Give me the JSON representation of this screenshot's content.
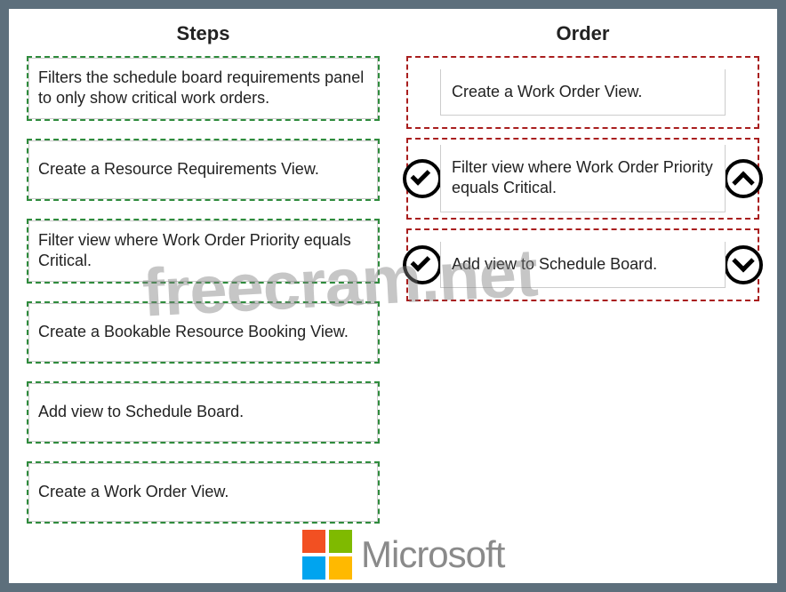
{
  "headers": {
    "steps": "Steps",
    "order": "Order"
  },
  "steps": [
    {
      "text": "Filters the schedule board requirements panel to only show critical work orders."
    },
    {
      "text": "Create a Resource Requirements View."
    },
    {
      "text": "Filter view where Work Order Priority equals Critical."
    },
    {
      "text": "Create a Bookable Resource Booking View."
    },
    {
      "text": "Add view to Schedule Board."
    },
    {
      "text": "Create a Work Order View."
    }
  ],
  "order": [
    {
      "text": "Create a Work Order View.",
      "left_icon": null,
      "right_icon": null
    },
    {
      "text": "Filter view where Work Order Priority equals Critical.",
      "left_icon": "check",
      "right_icon": "up"
    },
    {
      "text": "Add view to Schedule Board.",
      "left_icon": "check",
      "right_icon": "down"
    }
  ],
  "watermark": "freecram.net",
  "logo_text": "Microsoft"
}
